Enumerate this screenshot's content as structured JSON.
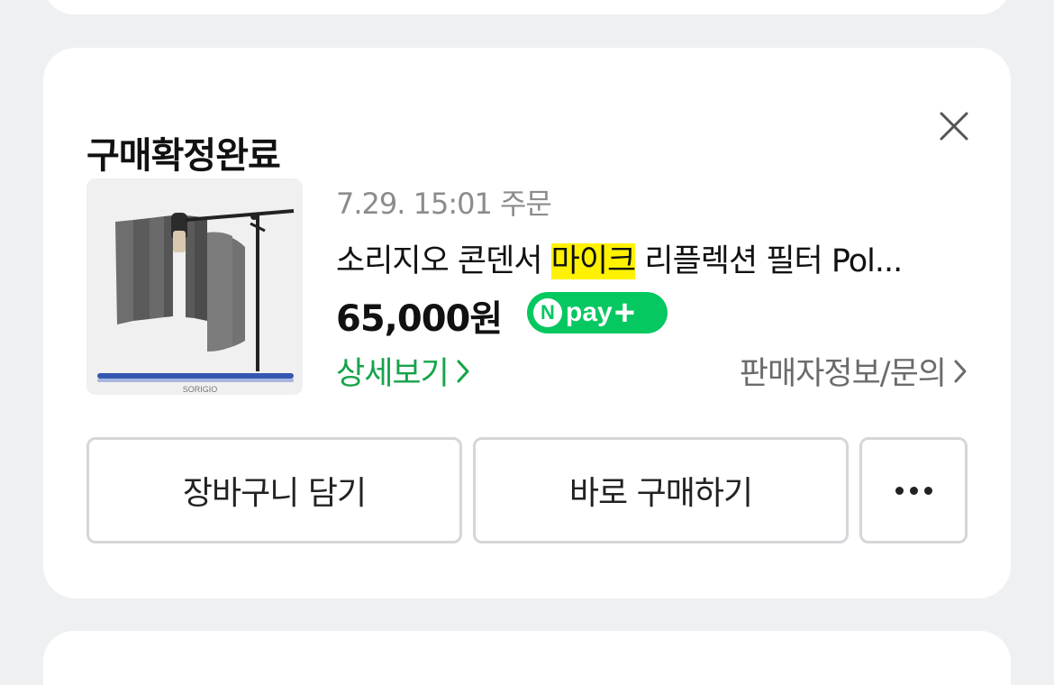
{
  "order": {
    "status_title": "구매확정완료",
    "date_text": "7.29. 15:01 주문",
    "product_title_prefix": "소리지오 콘덴서 ",
    "product_title_highlight": "마이크",
    "product_title_suffix": " 리플렉션 필터 Pol...",
    "price": "65,000원",
    "npay": {
      "n_letter": "N",
      "label": "pay",
      "plus": "+"
    },
    "detail_link": "상세보기",
    "seller_link": "판매자정보/문의",
    "thumbnail_brand": "SORIGIO"
  },
  "actions": {
    "cart_label": "장바구니 담기",
    "buy_label": "바로 구매하기"
  },
  "icons": {
    "close": "close-icon",
    "chevron": "chevron-right-icon",
    "more": "more-dots-icon"
  },
  "colors": {
    "background": "#eef0f2",
    "card": "#ffffff",
    "accent_green": "#16a34a",
    "npay_green": "#05c860",
    "highlight": "#fff200",
    "muted_text": "#8c8c8c"
  }
}
